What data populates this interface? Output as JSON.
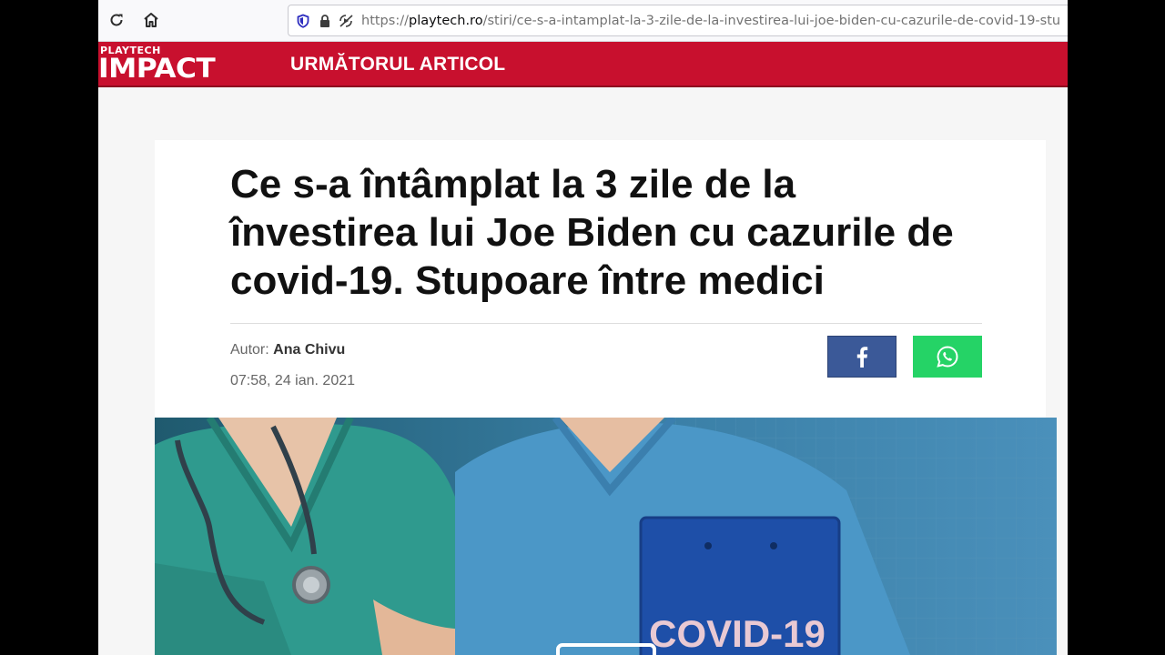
{
  "browser": {
    "url_prefix": "https://",
    "url_host": "playtech.ro",
    "url_path": "/stiri/ce-s-a-intamplat-la-3-zile-de-la-investirea-lui-joe-biden-cu-cazurile-de-covid-19-stu"
  },
  "header": {
    "logo_small": "PLAYTECH",
    "logo_big": "IMPACT",
    "next_article": "URMĂTORUL ARTICOL",
    "brand_color": "#c8102e"
  },
  "article": {
    "title": "Ce s-a întâmplat la 3 zile de la învestirea lui Joe Biden cu cazurile de covid-19. Stupoare între medici",
    "author_label": "Autor:",
    "author_name": "Ana Chivu",
    "date": "07:58, 24 ian. 2021"
  },
  "hero": {
    "clipboard_text": "COVID-19"
  },
  "share": {
    "facebook_color": "#3b5998",
    "whatsapp_color": "#25d366"
  }
}
